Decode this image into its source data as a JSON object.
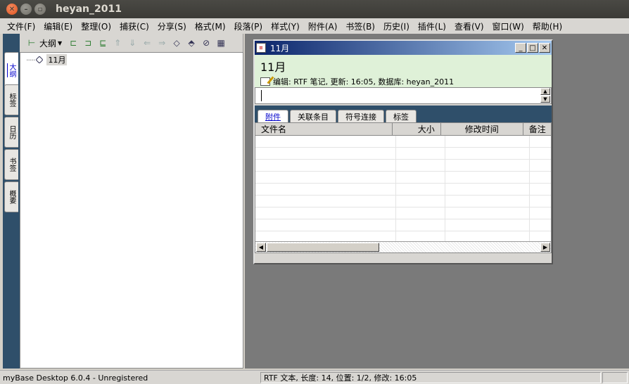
{
  "window": {
    "title": "heyan_2011"
  },
  "menu": [
    "文件(F)",
    "编辑(E)",
    "整理(O)",
    "捕获(C)",
    "分享(S)",
    "格式(M)",
    "段落(P)",
    "样式(Y)",
    "附件(A)",
    "书签(B)",
    "历史(I)",
    "插件(L)",
    "查看(V)",
    "窗口(W)",
    "帮助(H)"
  ],
  "sidetabs": [
    "大纲",
    "标签",
    "日历",
    "书签",
    "概要"
  ],
  "outline": {
    "button_label": "大纲",
    "node_label": "11月"
  },
  "doc": {
    "window_title": "11月",
    "heading": "11月",
    "meta": "编辑: RTF 笔记, 更新: 16:05, 数据库: heyan_2011",
    "tabs": [
      "附件",
      "关联条目",
      "符号连接",
      "标签"
    ],
    "columns": [
      "文件名",
      "大小",
      "修改时间",
      "备注"
    ]
  },
  "status": {
    "app": "myBase Desktop 6.0.4 - Unregistered",
    "info": "RTF 文本, 长度: 14, 位置: 1/2, 修改: 16:05"
  }
}
